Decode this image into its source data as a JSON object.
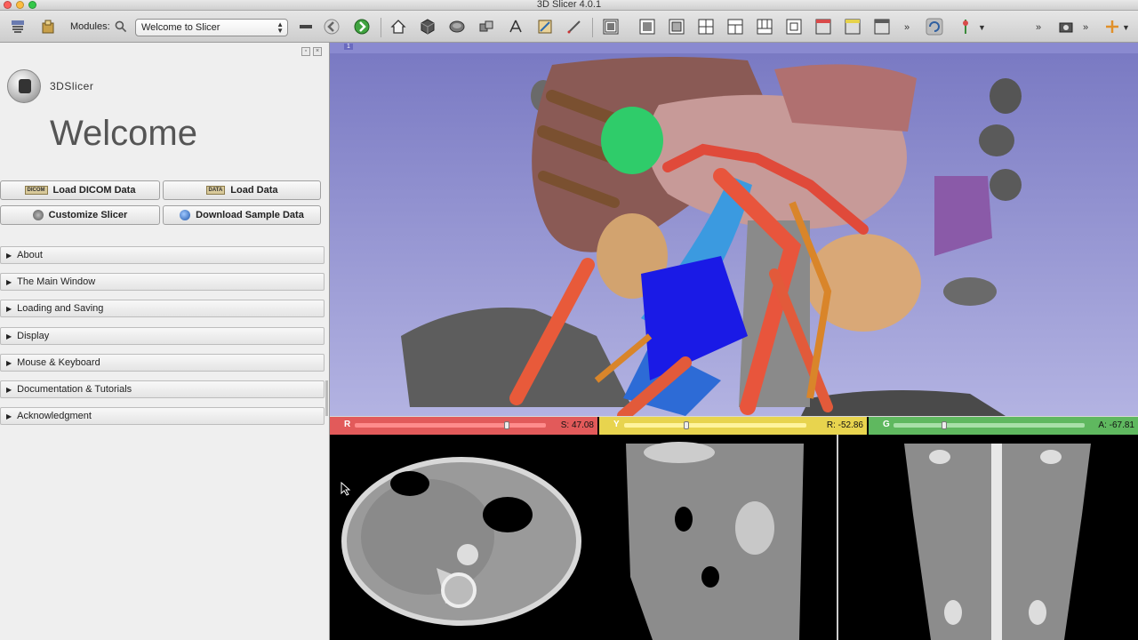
{
  "window": {
    "title": "3D Slicer 4.0.1"
  },
  "toolbar": {
    "modules_label": "Modules:",
    "module_selected": "Welcome to Slicer"
  },
  "left_panel": {
    "brand": "3DSlicer",
    "heading": "Welcome",
    "buttons": {
      "load_dicom": {
        "label": "Load DICOM Data",
        "badge": "DICOM"
      },
      "load_data": {
        "label": "Load Data",
        "badge": "DATA"
      },
      "customize": {
        "label": "Customize Slicer"
      },
      "download_sample": {
        "label": "Download Sample Data"
      }
    },
    "sections": [
      "About",
      "The Main Window",
      "Loading and Saving",
      "Display",
      "Mouse & Keyboard",
      "Documentation & Tutorials",
      "Acknowledgment"
    ]
  },
  "view3d": {
    "tag": "1"
  },
  "slice_views": {
    "red": {
      "letter": "R",
      "value": "S: 47.08",
      "color": "#e04848"
    },
    "yellow": {
      "letter": "Y",
      "value": "R: -52.86",
      "color": "#e6d24a"
    },
    "green": {
      "letter": "G",
      "value": "A: -67.81",
      "color": "#5cb85c"
    }
  },
  "colors": {
    "accent_red": "#e04848",
    "accent_yellow": "#e6d24a",
    "accent_green": "#5cb85c",
    "view_background": "#9696d2"
  },
  "icons": [
    "data-icon",
    "save-icon",
    "search-icon",
    "minus-icon",
    "back-icon",
    "forward-icon",
    "home-icon",
    "cube-icon",
    "volume-icon",
    "models-icon",
    "transforms-icon",
    "editor-icon",
    "ruler-icon",
    "layout-icons",
    "crosshair-icon",
    "screenshot-icon",
    "mouse-mode-icon"
  ]
}
